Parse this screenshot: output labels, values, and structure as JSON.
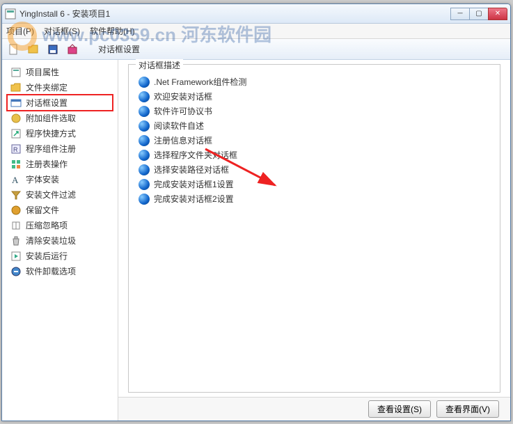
{
  "window": {
    "title": "YingInstall 6 - 安装项目1"
  },
  "menu": {
    "project": "项目(P)",
    "dialog": "对话框(S)",
    "help": "软件帮助(H)"
  },
  "breadcrumb": "对话框设置",
  "watermark": "www.pc0359.cn 河东软件园",
  "sidebar": {
    "items": [
      {
        "label": "项目属性",
        "icon": "props"
      },
      {
        "label": "文件夹绑定",
        "icon": "folder"
      },
      {
        "label": "对话框设置",
        "icon": "dialog",
        "highlighted": true
      },
      {
        "label": "附加组件选取",
        "icon": "addon"
      },
      {
        "label": "程序快捷方式",
        "icon": "shortcut"
      },
      {
        "label": "程序组件注册",
        "icon": "register"
      },
      {
        "label": "注册表操作",
        "icon": "registry"
      },
      {
        "label": "字体安装",
        "icon": "font"
      },
      {
        "label": "安装文件过滤",
        "icon": "filter"
      },
      {
        "label": "保留文件",
        "icon": "keep"
      },
      {
        "label": "压缩忽略项",
        "icon": "compress"
      },
      {
        "label": "清除安装垃圾",
        "icon": "clean"
      },
      {
        "label": "安装后运行",
        "icon": "run"
      },
      {
        "label": "软件卸载选项",
        "icon": "uninstall"
      }
    ]
  },
  "groupbox": {
    "title": "对话框描述",
    "items": [
      ".Net Framework组件检测",
      "欢迎安装对话框",
      "软件许可协议书",
      "阅读软件自述",
      "注册信息对话框",
      "选择程序文件夹对话框",
      "选择安装路径对话框",
      "完成安装对话框1设置",
      "完成安装对话框2设置"
    ]
  },
  "buttons": {
    "view_settings": "查看设置(S)",
    "view_interface": "查看界面(V)"
  }
}
